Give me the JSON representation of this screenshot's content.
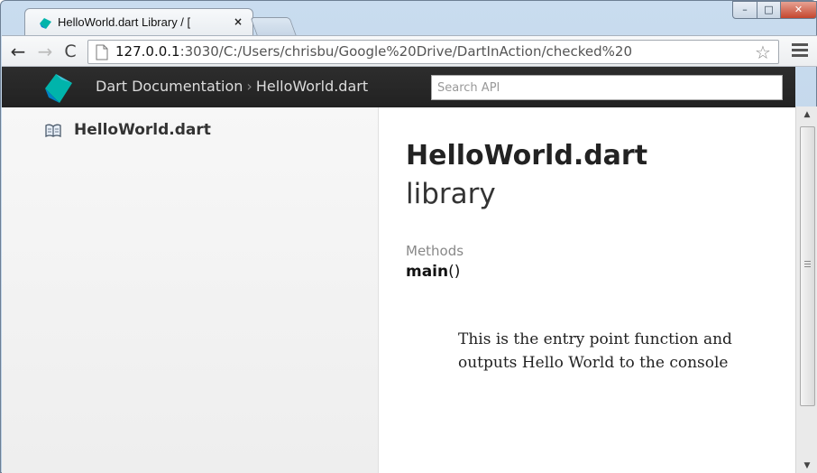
{
  "browser": {
    "tab_title": "HelloWorld.dart Library / [",
    "tab_close": "×",
    "url_host": "127.0.0.1",
    "url_rest": ":3030/C:/Users/chrisbu/Google%20Drive/DartInAction/checked%20",
    "window_controls": {
      "minimize": "–",
      "maximize": "□",
      "close": "✕"
    }
  },
  "navbar": {
    "crumb_root": "Dart Documentation",
    "crumb_sep": "›",
    "crumb_current": "HelloWorld.dart",
    "search_placeholder": "Search API"
  },
  "sidebar": {
    "items": [
      {
        "label": "HelloWorld.dart",
        "icon": "book-icon"
      }
    ]
  },
  "main": {
    "title": "HelloWorld.dart",
    "subtitle": "library",
    "methods_label": "Methods",
    "methods": [
      {
        "name": "main",
        "parens": "()",
        "description": "This is the entry point function and outputs Hello World to the console"
      }
    ]
  },
  "colors": {
    "navbar_bg": "#2d2d2d",
    "dart_teal": "#0081c6",
    "dart_cyan": "#00b4ab"
  }
}
